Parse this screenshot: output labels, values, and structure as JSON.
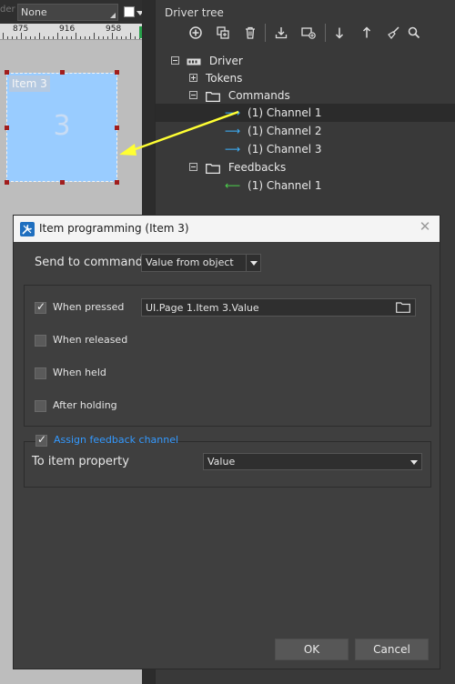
{
  "canvas_toolbar": {
    "border_label": "der",
    "border_value": "None",
    "fill_color": "#ffffff"
  },
  "ruler": {
    "ticks": [
      "875",
      "916",
      "958"
    ]
  },
  "canvas_item": {
    "name": "Item 3",
    "value": "3",
    "fill_color": "#99ccff"
  },
  "driver_tree": {
    "title": "Driver tree",
    "toolbar_icons": [
      "add-icon",
      "duplicate-icon",
      "delete-icon",
      "import-icon",
      "add-driver-icon",
      "move-down-icon",
      "move-up-icon",
      "clean-icon",
      "search-icon"
    ],
    "root": "Driver",
    "tokens": "Tokens",
    "commands": "Commands",
    "command_items": [
      "(1) Channel 1",
      "(1) Channel 2",
      "(1) Channel 3"
    ],
    "feedbacks": "Feedbacks",
    "feedback_items": [
      "(1) Channel 1"
    ]
  },
  "dialog": {
    "title": "Item programming  (Item 3)",
    "send_to_command_label": "Send to command",
    "send_to_command_value": "Value from object",
    "events": [
      {
        "label": "When pressed",
        "checked": true
      },
      {
        "label": "When released",
        "checked": false
      },
      {
        "label": "When held",
        "checked": false
      },
      {
        "label": "After holding",
        "checked": false
      }
    ],
    "pressed_value": "UI.Page 1.Item 3.Value",
    "assign_feedback_label": "Assign  feedback channel",
    "assign_feedback_checked": true,
    "to_item_property_label": "To item property",
    "to_item_property_value": "Value",
    "ok_label": "OK",
    "cancel_label": "Cancel"
  },
  "colors": {
    "accent": "#3399ff",
    "command_arrow": "#3db2ff",
    "feedback_arrow": "#4ccf4c",
    "drag_arrow": "#ffff33",
    "selection_handle": "#a11d1d"
  }
}
